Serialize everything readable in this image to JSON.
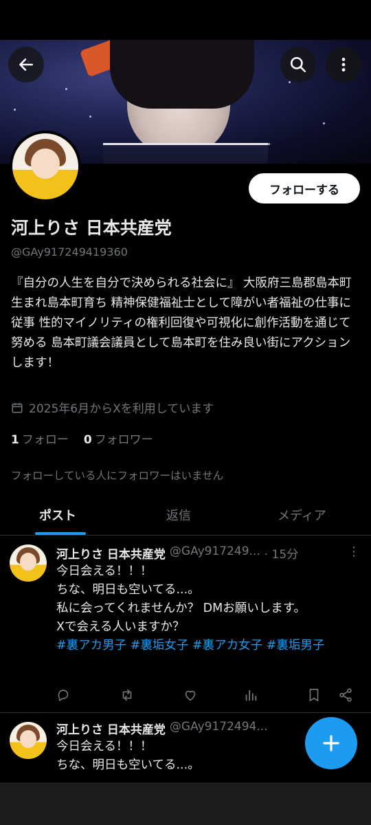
{
  "header": {
    "back_icon": "arrow-left-icon",
    "search_icon": "search-icon",
    "more_icon": "vertical-dots-icon"
  },
  "profile": {
    "follow_button_label": "フォローする",
    "display_name": "河上りさ 日本共産党",
    "handle": "@GAy917249419360",
    "bio": "『自分の人生を自分で決められる社会に』 大阪府三島郡島本町生まれ島本町育ち 精神保健福祉士として障がい者福祉の仕事に従事 性的マイノリティの権利回復や可視化に創作活動を通じて努める 島本町議会議員として島本町を住み良い街にアクションします！",
    "joined_text": "2025年6月からXを利用しています",
    "following_count": "1",
    "following_label": "フォロー",
    "followers_count": "0",
    "followers_label": "フォロワー",
    "no_followers_note": "フォローしている人にフォロワーはいません"
  },
  "tabs": [
    {
      "label": "ポスト",
      "active": true
    },
    {
      "label": "返信",
      "active": false
    },
    {
      "label": "メディア",
      "active": false
    }
  ],
  "posts": [
    {
      "name": "河上りさ 日本共産党",
      "handle": "@GAy917249...",
      "time": "· 15分",
      "lines": [
        "今日会える！！！",
        "ちな、明日も空いてる...。",
        "私に会ってくれませんか？ DMお願いします。",
        "Xで会える人いますか？"
      ],
      "hashtags": "#裏アカ男子 #裏垢女子 #裏アカ女子 #裏垢男子"
    },
    {
      "name": "河上りさ 日本共産党",
      "handle": "@GAy9172494...",
      "lines": [
        "今日会える！！！",
        "ちな、明日も空いてる...。"
      ]
    }
  ],
  "colors": {
    "accent": "#1d9bf0",
    "background": "#000000",
    "muted_text": "#71767b"
  }
}
